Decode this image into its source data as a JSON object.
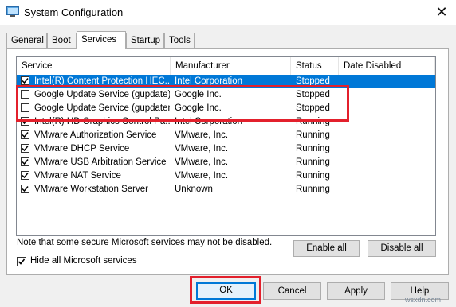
{
  "window": {
    "title": "System Configuration",
    "close_glyph": "✕"
  },
  "tabs": [
    {
      "label": "General",
      "active": false
    },
    {
      "label": "Boot",
      "active": false
    },
    {
      "label": "Services",
      "active": true
    },
    {
      "label": "Startup",
      "active": false
    },
    {
      "label": "Tools",
      "active": false
    }
  ],
  "services": {
    "columns": [
      "Service",
      "Manufacturer",
      "Status",
      "Date Disabled"
    ],
    "rows": [
      {
        "checked": true,
        "service": "Intel(R) Content Protection HEC...",
        "manufacturer": "Intel Corporation",
        "status": "Stopped",
        "date_disabled": ""
      },
      {
        "checked": false,
        "service": "Google Update Service (gupdate)",
        "manufacturer": "Google Inc.",
        "status": "Stopped",
        "date_disabled": ""
      },
      {
        "checked": false,
        "service": "Google Update Service (gupdatem)",
        "manufacturer": "Google Inc.",
        "status": "Stopped",
        "date_disabled": ""
      },
      {
        "checked": true,
        "service": "Intel(R) HD Graphics Control Pa...",
        "manufacturer": "Intel Corporation",
        "status": "Running",
        "date_disabled": ""
      },
      {
        "checked": true,
        "service": "VMware Authorization Service",
        "manufacturer": "VMware, Inc.",
        "status": "Running",
        "date_disabled": ""
      },
      {
        "checked": true,
        "service": "VMware DHCP Service",
        "manufacturer": "VMware, Inc.",
        "status": "Running",
        "date_disabled": ""
      },
      {
        "checked": true,
        "service": "VMware USB Arbitration Service",
        "manufacturer": "VMware, Inc.",
        "status": "Running",
        "date_disabled": ""
      },
      {
        "checked": true,
        "service": "VMware NAT Service",
        "manufacturer": "VMware, Inc.",
        "status": "Running",
        "date_disabled": ""
      },
      {
        "checked": true,
        "service": "VMware Workstation Server",
        "manufacturer": "Unknown",
        "status": "Running",
        "date_disabled": ""
      }
    ]
  },
  "note": "Note that some secure Microsoft services may not be disabled.",
  "buttons": {
    "enable_all": "Enable all",
    "disable_all": "Disable all",
    "ok": "OK",
    "cancel": "Cancel",
    "apply": "Apply",
    "help": "Help"
  },
  "hide_ms": {
    "label": "Hide all Microsoft services",
    "checked": true
  },
  "watermark": "wsxdn.com",
  "colors": {
    "selection": "#0078d7",
    "highlight": "#e3202c"
  }
}
